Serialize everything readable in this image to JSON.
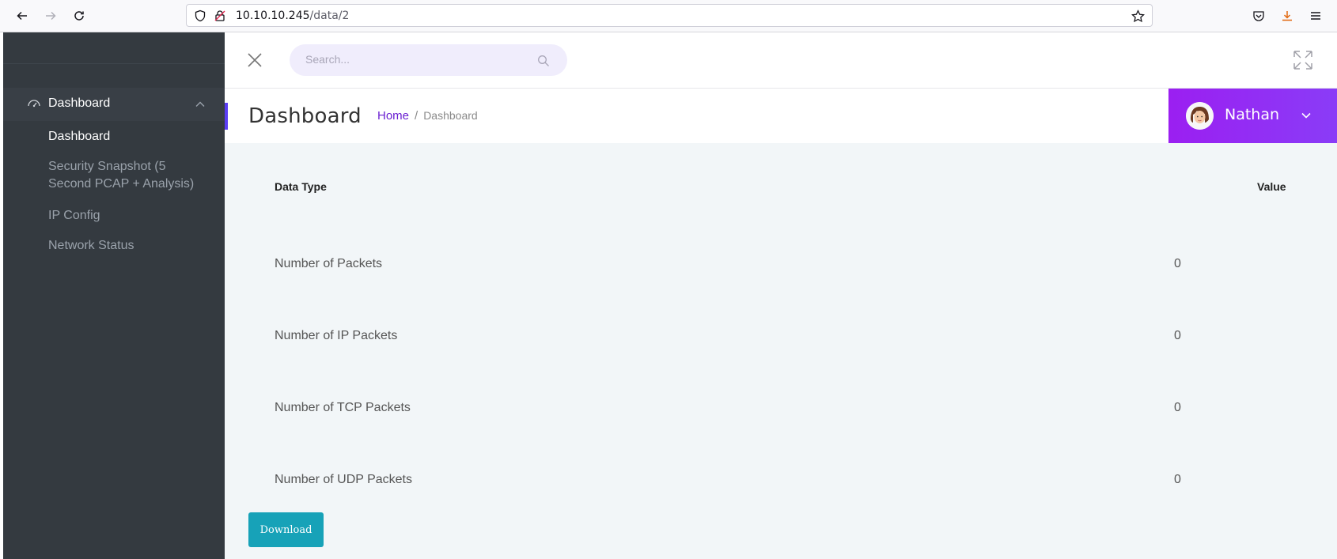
{
  "browser": {
    "url_host": "10.10.10.245",
    "url_path": "/data/2"
  },
  "sidebar": {
    "section": {
      "label": "Dashboard",
      "icon": "dashboard-gauge-icon"
    },
    "items": [
      {
        "label": "Dashboard",
        "active": true
      },
      {
        "label": "Security Snapshot (5 Second PCAP + Analysis)",
        "active": false
      },
      {
        "label": "IP Config",
        "active": false
      },
      {
        "label": "Network Status",
        "active": false
      }
    ]
  },
  "header": {
    "search_placeholder": "Search..."
  },
  "titlebar": {
    "title": "Dashboard",
    "breadcrumb": {
      "home": "Home",
      "separator": "/",
      "current": "Dashboard"
    },
    "user": {
      "name": "Nathan"
    }
  },
  "table": {
    "headers": {
      "type": "Data Type",
      "value": "Value"
    },
    "rows": [
      {
        "label": "Number of Packets",
        "value": "0"
      },
      {
        "label": "Number of IP Packets",
        "value": "0"
      },
      {
        "label": "Number of TCP Packets",
        "value": "0"
      },
      {
        "label": "Number of UDP Packets",
        "value": "0"
      }
    ]
  },
  "actions": {
    "download_label": "Download"
  },
  "colors": {
    "sidebar_bg": "#343a40",
    "accent_purple": "#9b1ff1",
    "breadcrumb_link": "#6a1fd1",
    "download_bg": "#17a2b8",
    "content_bg": "#f2f6f8"
  }
}
